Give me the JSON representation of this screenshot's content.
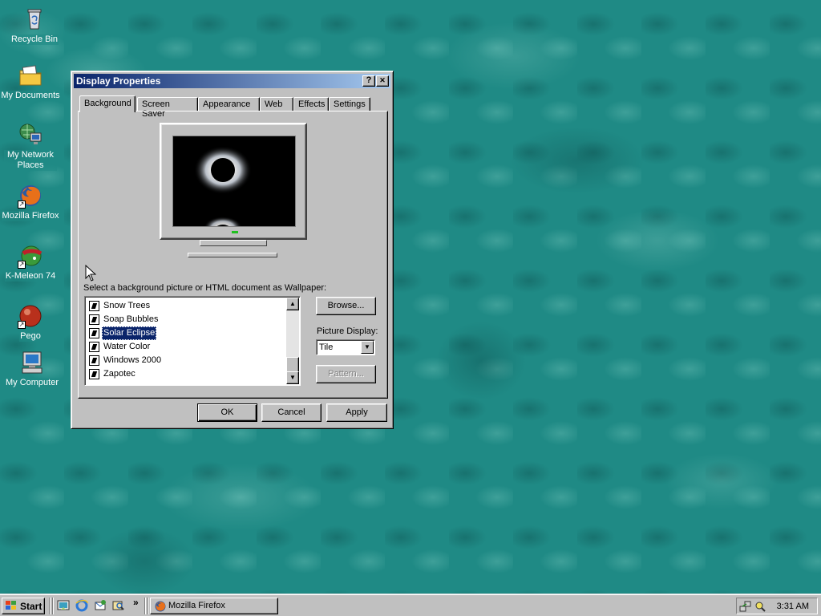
{
  "desktop": {
    "icons": [
      {
        "label": "Recycle Bin"
      },
      {
        "label": "My Documents"
      },
      {
        "label": "My Network Places"
      },
      {
        "label": "Mozilla Firefox"
      },
      {
        "label": "K-Meleon 74"
      },
      {
        "label": "Pego"
      },
      {
        "label": "My Computer"
      }
    ]
  },
  "dialog": {
    "title": "Display Properties",
    "help_button": "?",
    "close_button": "✕",
    "tabs": [
      "Background",
      "Screen Saver",
      "Appearance",
      "Web",
      "Effects",
      "Settings"
    ],
    "active_tab": "Background",
    "prompt": "Select a background picture or HTML document as Wallpaper:",
    "wallpapers": [
      "Snow Trees",
      "Soap Bubbles",
      "Solar Eclipse",
      "Water Color",
      "Windows 2000",
      "Zapotec"
    ],
    "selected_wallpaper": "Solar Eclipse",
    "browse_label": "Browse...",
    "picture_display_label": "Picture Display:",
    "picture_display_value": "Tile",
    "pattern_label": "Pattern...",
    "ok_label": "OK",
    "cancel_label": "Cancel",
    "apply_label": "Apply"
  },
  "taskbar": {
    "start_label": "Start",
    "chevron": "»",
    "task_label": "Mozilla Firefox",
    "clock": "3:31 AM"
  },
  "colors": {
    "desktop": "#1f8a85",
    "title_active_start": "#0a246a",
    "title_active_end": "#a6caf0",
    "selection": "#0a246a",
    "face": "#c0c0c0"
  }
}
